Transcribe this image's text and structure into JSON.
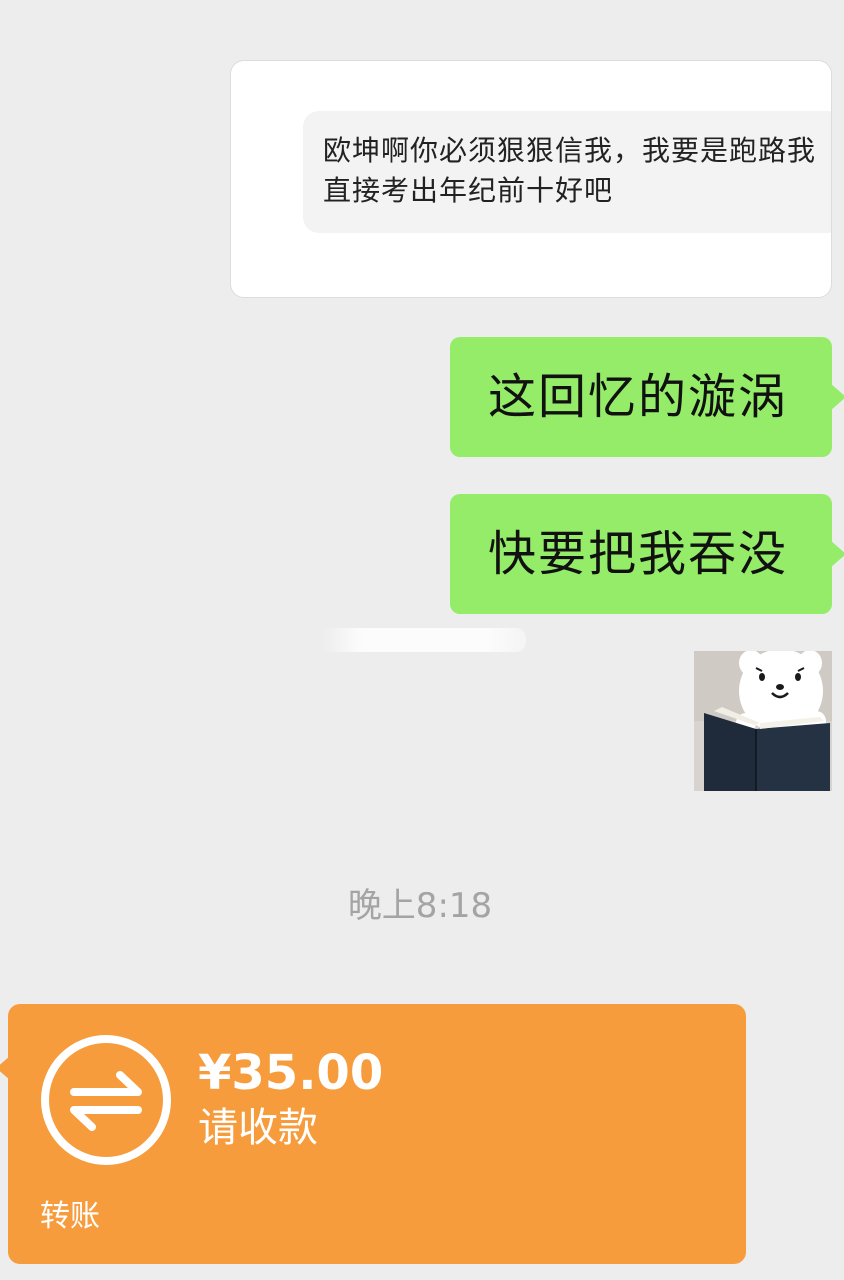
{
  "chat": {
    "quoted_message": {
      "text": "欧坤啊你必须狠狠信我，我要是跑路我直接考出年纪前十好吧"
    },
    "messages": [
      {
        "text": "这回忆的漩涡"
      },
      {
        "text": "快要把我吞没"
      }
    ],
    "sticker": {
      "icon": "bear-reading-book-sticker"
    },
    "timestamp": "晚上8:18"
  },
  "transfer": {
    "amount": "¥35.00",
    "status": "请收款",
    "label": "转账",
    "icon": "transfer-arrows-icon",
    "color": "#f79c3d"
  },
  "colors": {
    "background": "#ededed",
    "outgoing_bubble": "#95ec69",
    "timestamp_text": "#a4a4a4"
  }
}
